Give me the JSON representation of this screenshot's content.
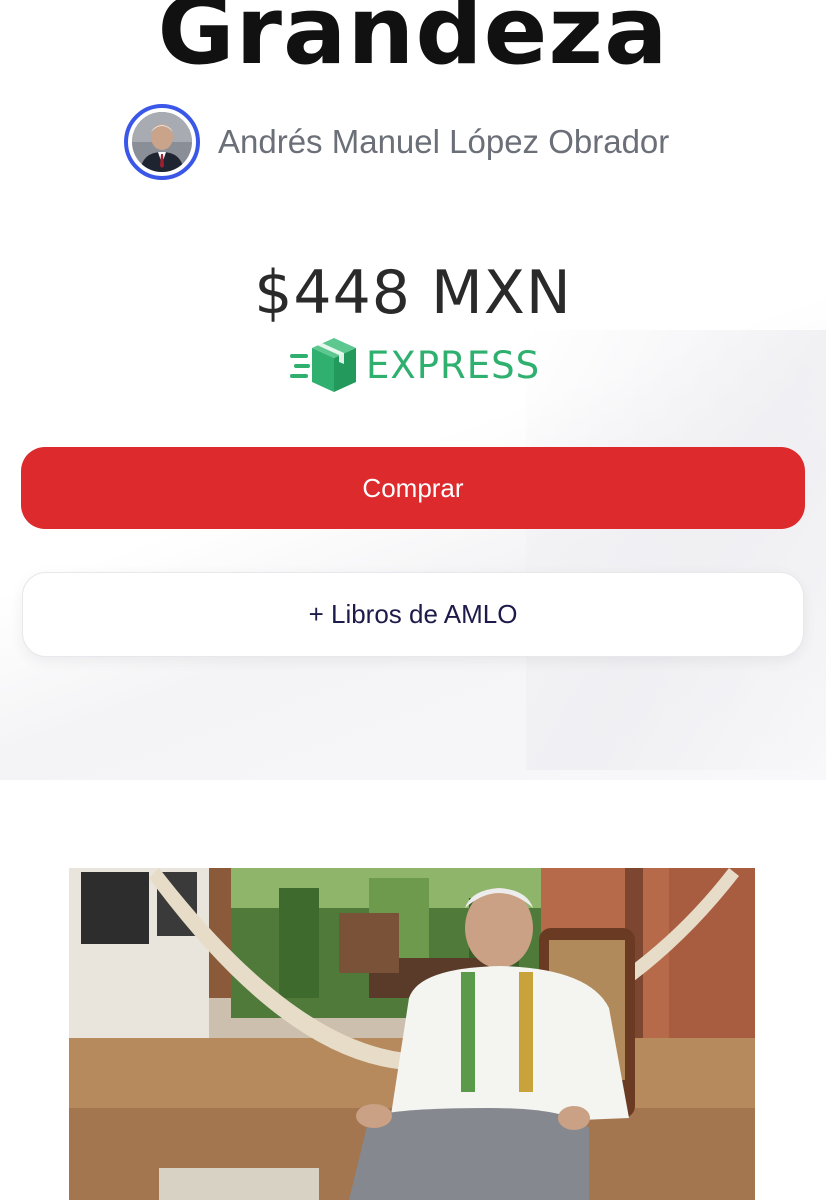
{
  "book": {
    "title": "Grandeza",
    "author": "Andrés Manuel López Obrador",
    "price": "$448 MXN",
    "shipping_badge": "EXPRESS"
  },
  "actions": {
    "buy_label": "Comprar",
    "more_books_label": "+ Libros de AMLO"
  },
  "icons": {
    "shipping": "express-box-icon"
  },
  "colors": {
    "buy_button": "#dc2a2d",
    "express_green": "#2fb06e",
    "avatar_ring": "#3a57e8",
    "more_text": "#1d1b4a"
  }
}
